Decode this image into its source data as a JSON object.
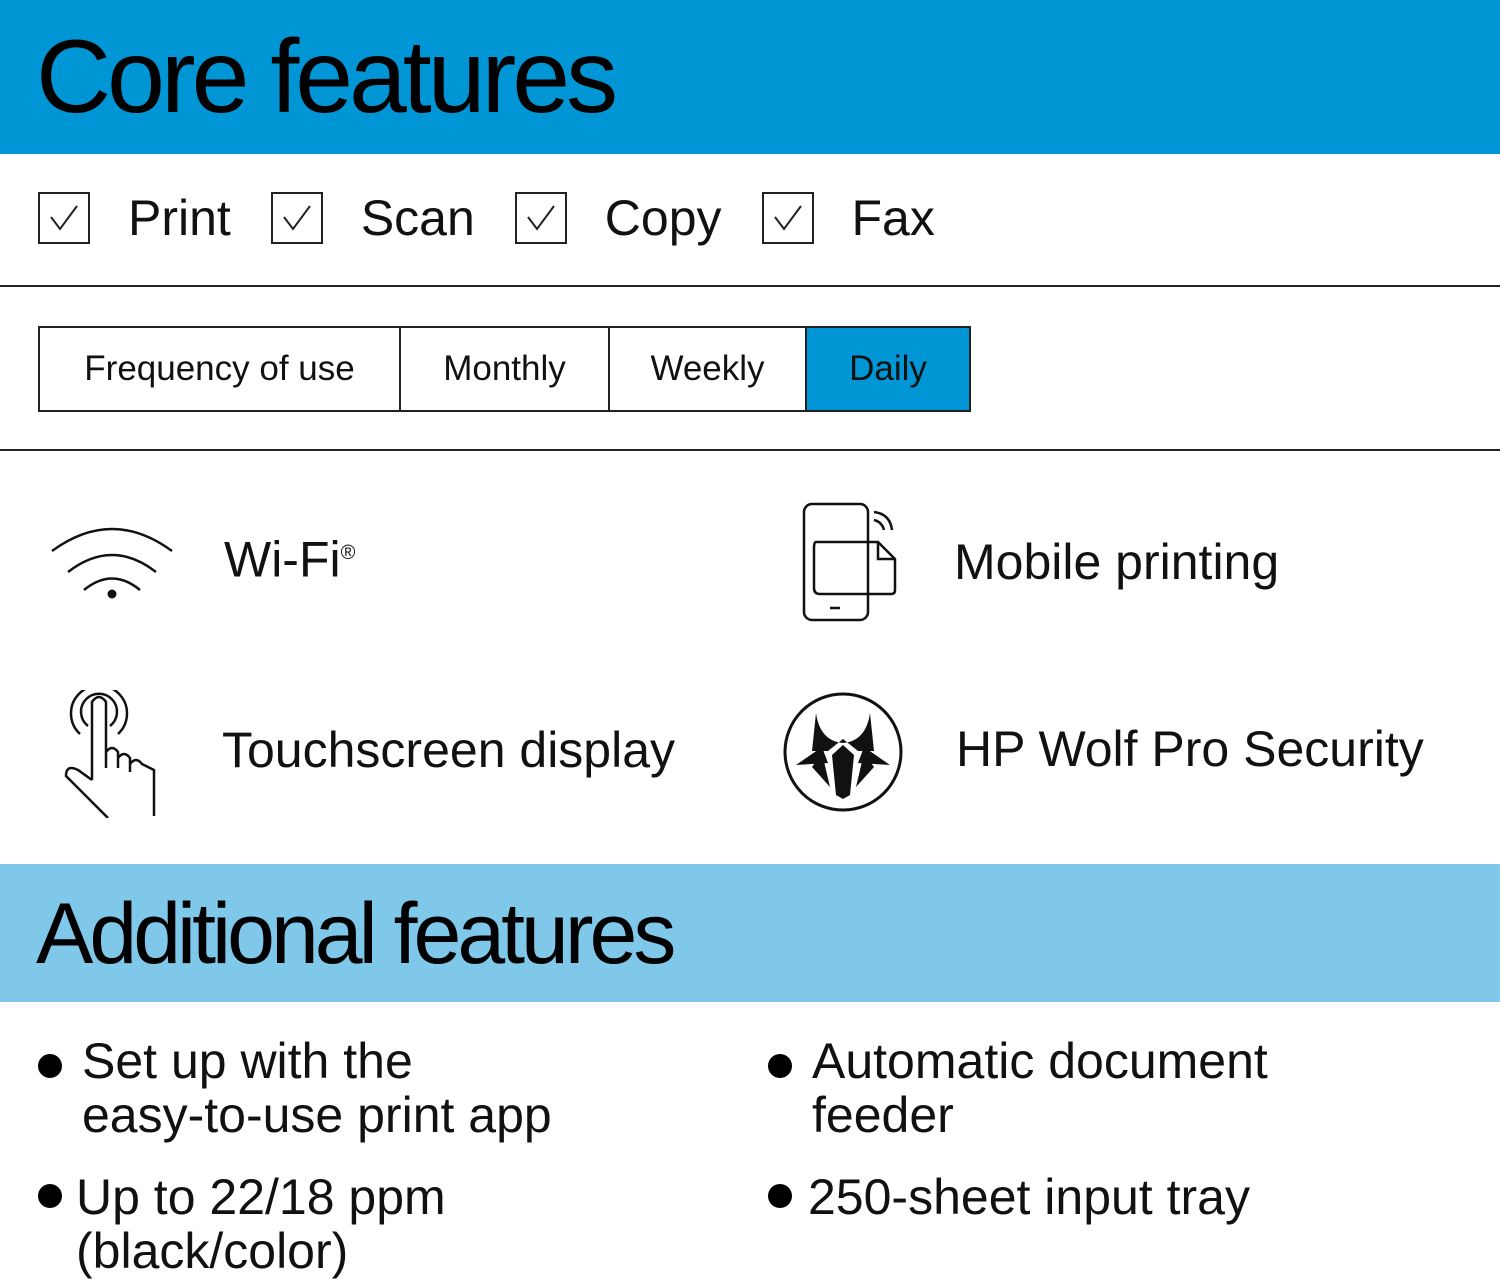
{
  "core": {
    "title": "Core features",
    "functions": [
      {
        "label": "Print",
        "checked": true
      },
      {
        "label": "Scan",
        "checked": true
      },
      {
        "label": "Copy",
        "checked": true
      },
      {
        "label": "Fax",
        "checked": true
      }
    ],
    "frequency": {
      "label": "Frequency of use",
      "options": [
        "Monthly",
        "Weekly",
        "Daily"
      ],
      "selected": "Daily"
    },
    "features": [
      {
        "icon": "wifi-icon",
        "label": "Wi-Fi",
        "mark": "®"
      },
      {
        "icon": "mobile-printing-icon",
        "label": "Mobile printing"
      },
      {
        "icon": "touchscreen-icon",
        "label": "Touchscreen display"
      },
      {
        "icon": "wolf-security-icon",
        "label": "HP Wolf Pro Security"
      }
    ]
  },
  "additional": {
    "title": "Additional features",
    "items": [
      {
        "line1": "Set up with the",
        "line2": "easy-to-use print app"
      },
      {
        "line1": "Automatic document",
        "line2": "feeder"
      },
      {
        "line1": "Up to 22/18 ppm",
        "line2": "(black/color)"
      },
      {
        "line1": "250-sheet input tray",
        "line2": ""
      }
    ]
  },
  "colors": {
    "primary_blue": "#0096D6",
    "light_blue": "#80C8EA"
  }
}
